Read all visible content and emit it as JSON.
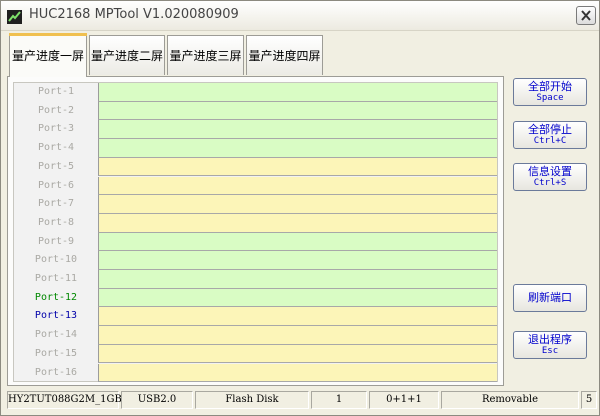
{
  "window": {
    "title": "HUC2168 MPTool V1.020080909"
  },
  "tabs": [
    {
      "label": "量产进度一屏",
      "active": true
    },
    {
      "label": "量产进度二屏",
      "active": false
    },
    {
      "label": "量产进度三屏",
      "active": false
    },
    {
      "label": "量产进度四屏",
      "active": false
    }
  ],
  "ports": [
    {
      "label": "Port-1",
      "bar_color": "#d9fcc4",
      "label_color": "#aaa9a4"
    },
    {
      "label": "Port-2",
      "bar_color": "#d9fcc4",
      "label_color": "#aaa9a4"
    },
    {
      "label": "Port-3",
      "bar_color": "#d9fcc4",
      "label_color": "#aaa9a4"
    },
    {
      "label": "Port-4",
      "bar_color": "#d9fcc4",
      "label_color": "#aaa9a4"
    },
    {
      "label": "Port-5",
      "bar_color": "#fcf5b8",
      "label_color": "#aaa9a4"
    },
    {
      "label": "Port-6",
      "bar_color": "#fcf5b8",
      "label_color": "#aaa9a4"
    },
    {
      "label": "Port-7",
      "bar_color": "#fcf5b8",
      "label_color": "#aaa9a4"
    },
    {
      "label": "Port-8",
      "bar_color": "#fcf5b8",
      "label_color": "#aaa9a4"
    },
    {
      "label": "Port-9",
      "bar_color": "#d9fcc4",
      "label_color": "#aaa9a4"
    },
    {
      "label": "Port-10",
      "bar_color": "#d9fcc4",
      "label_color": "#aaa9a4"
    },
    {
      "label": "Port-11",
      "bar_color": "#d9fcc4",
      "label_color": "#aaa9a4"
    },
    {
      "label": "Port-12",
      "bar_color": "#d9fcc4",
      "label_color": "#008800"
    },
    {
      "label": "Port-13",
      "bar_color": "#fcf5b8",
      "label_color": "#0000aa"
    },
    {
      "label": "Port-14",
      "bar_color": "#fcf5b8",
      "label_color": "#aaa9a4"
    },
    {
      "label": "Port-15",
      "bar_color": "#fcf5b8",
      "label_color": "#aaa9a4"
    },
    {
      "label": "Port-16",
      "bar_color": "#fcf5b8",
      "label_color": "#aaa9a4"
    }
  ],
  "buttons": {
    "start_all": {
      "label": "全部开始",
      "shortcut": "Space"
    },
    "stop_all": {
      "label": "全部停止",
      "shortcut": "Ctrl+C"
    },
    "info_settings": {
      "label": "信息设置",
      "shortcut": "Ctrl+S"
    },
    "refresh_ports": {
      "label": "刷新端口"
    },
    "exit_program": {
      "label": "退出程序",
      "shortcut": "Esc"
    }
  },
  "status": {
    "device_model": "HY2TUT088G2M_1GB",
    "interface": "USB2.0",
    "media_type": "Flash Disk",
    "count": "1",
    "lun_info": "0+1+1",
    "removable": "Removable",
    "port_total": "5"
  },
  "colors": {
    "accent_tab": "#f0c050",
    "button_text": "#0000cc",
    "bar_green": "#d9fcc4",
    "bar_yellow": "#fcf5b8"
  }
}
